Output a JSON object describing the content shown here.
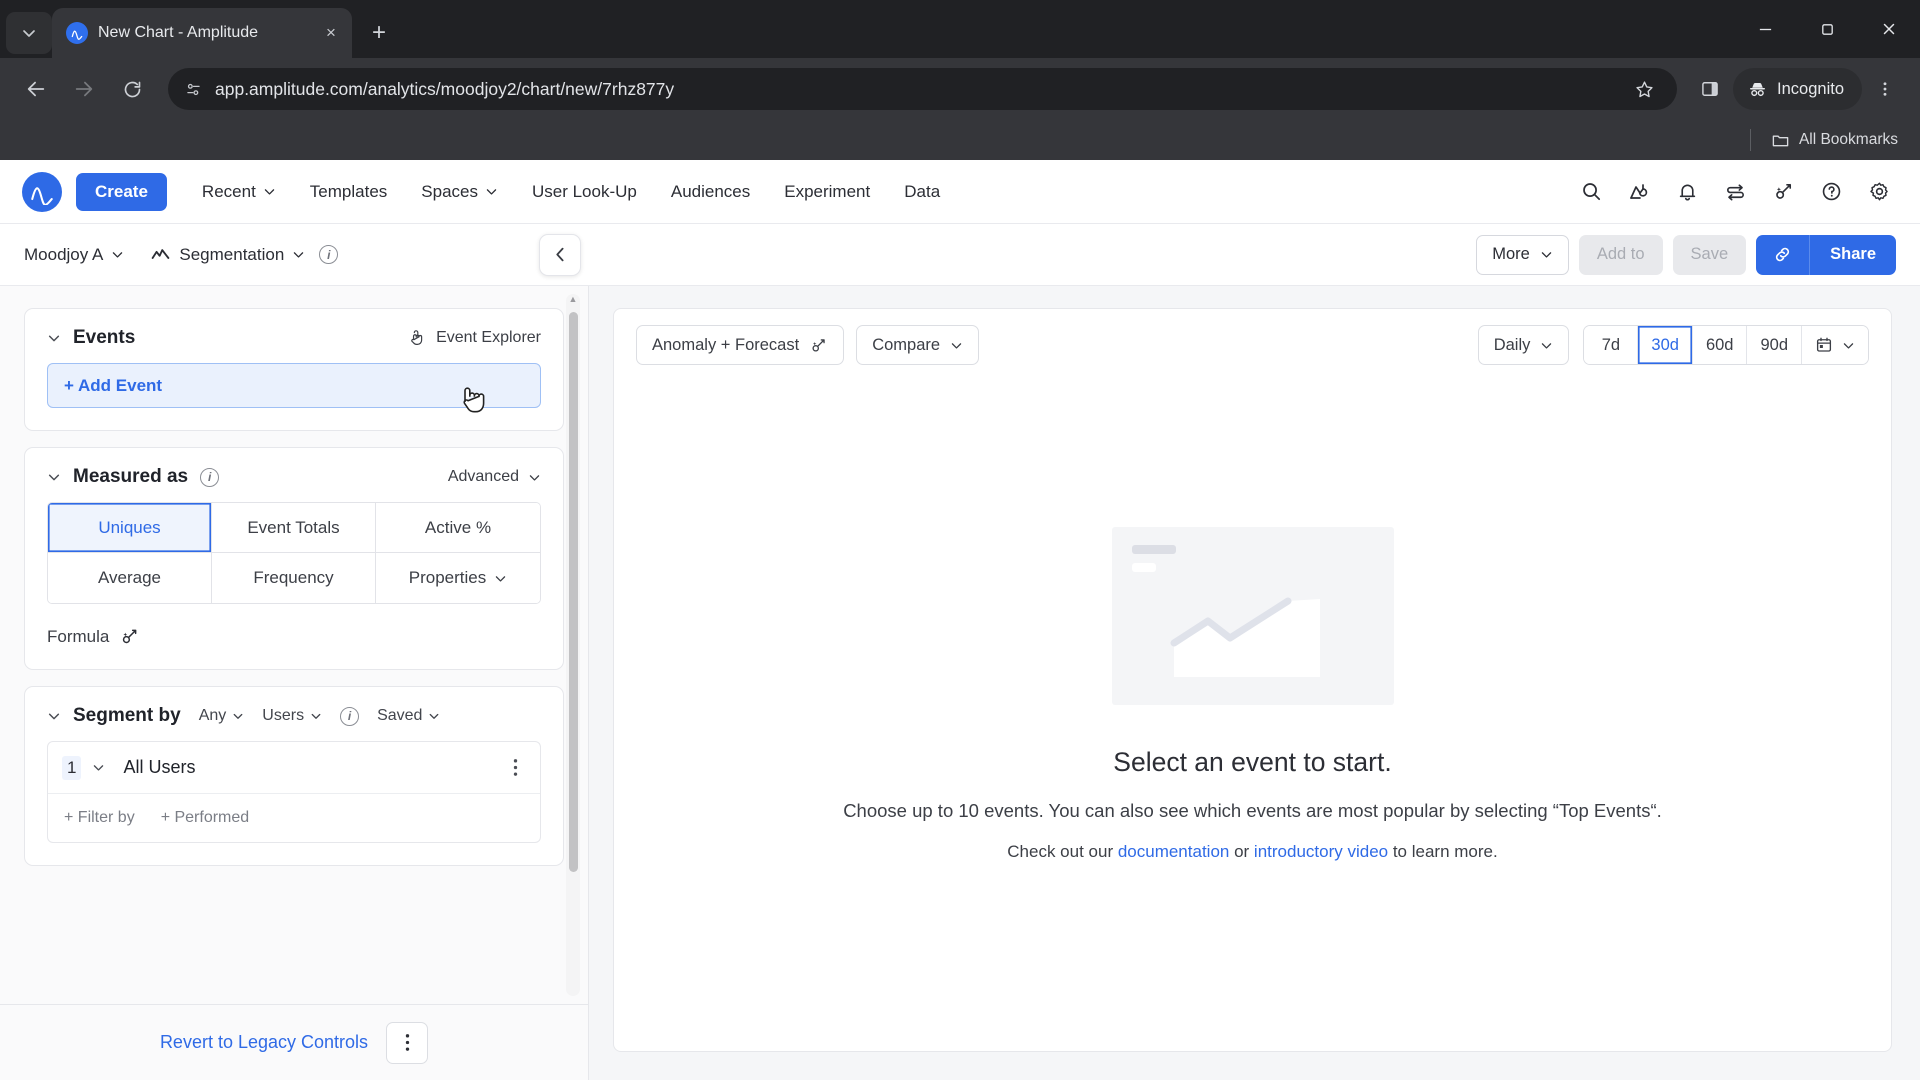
{
  "browser": {
    "tab": {
      "title": "New Chart - Amplitude",
      "favicon": "amplitude-icon",
      "close": "×"
    },
    "new_tab_label": "+",
    "tab_list_icon": "chevron-down-icon",
    "window": {
      "minimize": "—",
      "maximize": "▢",
      "close": "✕"
    },
    "nav": {
      "back": "back-icon",
      "forward": "forward-icon",
      "reload": "reload-icon"
    },
    "omnibox": {
      "url": "app.amplitude.com/analytics/moodjoy2/chart/new/7rhz877y",
      "site_info_icon": "page-info-icon",
      "bookmark_icon": "star-icon",
      "sidepanel_icon": "side-panel-icon",
      "menu_icon": "three-dot-menu-icon"
    },
    "profile": {
      "label": "Incognito",
      "icon": "incognito-icon"
    },
    "bookmarks": {
      "all_label": "All Bookmarks",
      "folder_icon": "folder-icon"
    }
  },
  "appnav": {
    "logo": "amplitude-logo",
    "create_label": "Create",
    "links": [
      {
        "label": "Recent",
        "caret": "⌄"
      },
      {
        "label": "Templates",
        "caret": ""
      },
      {
        "label": "Spaces",
        "caret": "⌄"
      },
      {
        "label": "User Look-Up",
        "caret": ""
      },
      {
        "label": "Audiences",
        "caret": ""
      },
      {
        "label": "Experiment",
        "caret": ""
      },
      {
        "label": "Data",
        "caret": ""
      }
    ],
    "icons": [
      "search-icon",
      "snail-chart-icon",
      "bell-icon",
      "swap-arrows-icon",
      "magic-wand-icon",
      "help-circle-icon",
      "gear-icon"
    ]
  },
  "chartbar": {
    "workspace": {
      "label": "Moodjoy A",
      "caret": "⌄"
    },
    "chart_type": {
      "label": "Segmentation",
      "caret": "⌄",
      "icon": "line-chart-icon"
    },
    "info_icon": "info-icon",
    "collapse_icon": "chevron-left-icon",
    "more": {
      "label": "More",
      "caret": "⌄"
    },
    "add_to": "Add to",
    "save": "Save",
    "link_icon": "link-icon",
    "share": "Share"
  },
  "sidebar": {
    "events": {
      "title": "Events",
      "caret": "⌄",
      "event_explorer": {
        "label": "Event Explorer",
        "icon": "cursor-click-icon"
      },
      "add_event": "+ Add Event"
    },
    "measured_as": {
      "title": "Measured as",
      "caret": "⌄",
      "info_icon": "info-icon",
      "advanced": {
        "label": "Advanced",
        "caret": "⌄"
      },
      "options": [
        {
          "label": "Uniques",
          "selected": true
        },
        {
          "label": "Event Totals",
          "selected": false
        },
        {
          "label": "Active %",
          "selected": false
        },
        {
          "label": "Average",
          "selected": false
        },
        {
          "label": "Frequency",
          "selected": false
        },
        {
          "label": "Properties",
          "selected": false,
          "caret": "⌄"
        }
      ],
      "formula": {
        "label": "Formula",
        "icon": "magic-wand-icon"
      }
    },
    "segment_by": {
      "title": "Segment by",
      "caret": "⌄",
      "any": {
        "label": "Any",
        "caret": "⌄"
      },
      "users": {
        "label": "Users",
        "caret": "⌄"
      },
      "info_icon": "info-icon",
      "saved": {
        "label": "Saved",
        "caret": "⌄"
      },
      "row": {
        "number": "1",
        "caret": "⌄",
        "name": "All Users",
        "kebab_icon": "kebab-menu-icon",
        "filter_by": "+ Filter by",
        "performed": "+ Performed"
      }
    },
    "footer": {
      "legacy_link": "Revert to Legacy Controls",
      "kebab_icon": "kebab-menu-icon"
    }
  },
  "main": {
    "anomaly": {
      "label": "Anomaly + Forecast",
      "icon": "magic-wand-icon"
    },
    "compare": {
      "label": "Compare",
      "caret": "⌄"
    },
    "interval": {
      "label": "Daily",
      "caret": "⌄"
    },
    "ranges": [
      {
        "label": "7d",
        "selected": false
      },
      {
        "label": "30d",
        "selected": true
      },
      {
        "label": "60d",
        "selected": false
      },
      {
        "label": "90d",
        "selected": false
      }
    ],
    "calendar": {
      "icon": "calendar-icon",
      "caret": "⌄"
    },
    "empty": {
      "illustration": "line-chart-placeholder",
      "title": "Select an event to start.",
      "subtitle": "Choose up to 10 events. You can also see which events are most popular by selecting “Top Events“.",
      "note_prefix": "Check out our ",
      "note_link1": "documentation",
      "note_mid": " or ",
      "note_link2": "introductory video",
      "note_suffix": " to learn more."
    }
  },
  "colors": {
    "accent": "#2f6ae6",
    "chrome_bg": "#35363a",
    "chrome_dark": "#202124"
  }
}
